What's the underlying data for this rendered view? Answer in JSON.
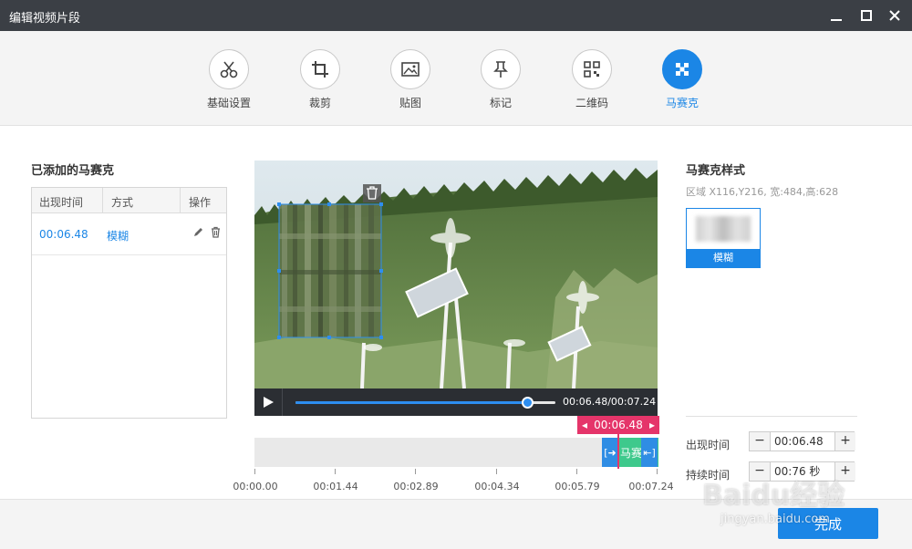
{
  "window": {
    "title": "编辑视频片段"
  },
  "toolbar": {
    "tools": [
      {
        "label": "基础设置",
        "icon": "scissors-icon"
      },
      {
        "label": "裁剪",
        "icon": "crop-icon"
      },
      {
        "label": "贴图",
        "icon": "image-icon"
      },
      {
        "label": "标记",
        "icon": "pin-icon"
      },
      {
        "label": "二维码",
        "icon": "qrcode-icon"
      },
      {
        "label": "马赛克",
        "icon": "mosaic-icon",
        "active": true
      }
    ]
  },
  "mosaic_list": {
    "title": "已添加的马赛克",
    "columns": [
      "出现时间",
      "方式",
      "操作"
    ],
    "rows": [
      {
        "time": "00:06.48",
        "mode": "模糊"
      }
    ]
  },
  "player": {
    "time_display": "00:06.48/00:07.24",
    "progress": 0.89
  },
  "timeline": {
    "playhead_time": "00:06.48",
    "clip_label": "马赛克:",
    "ticks": [
      "00:00.00",
      "00:01.44",
      "00:02.89",
      "00:04.34",
      "00:05.79",
      "00:07.24"
    ]
  },
  "style_panel": {
    "title": "马赛克样式",
    "region": "区域 X116,Y216, 宽:484,高:628",
    "style_name": "模糊",
    "appear_label": "出现时间",
    "appear_value": "00:06.48",
    "duration_label": "持续时间",
    "duration_value": "00:76 秒"
  },
  "footer": {
    "done_label": "完成"
  },
  "watermark": {
    "brand": "Baidu经验",
    "url": "jingyan.baidu.com"
  },
  "colors": {
    "accent": "#1b86e6",
    "playhead": "#e5356a",
    "clip": "#3ec98c",
    "titlebar": "#3b3f45"
  }
}
